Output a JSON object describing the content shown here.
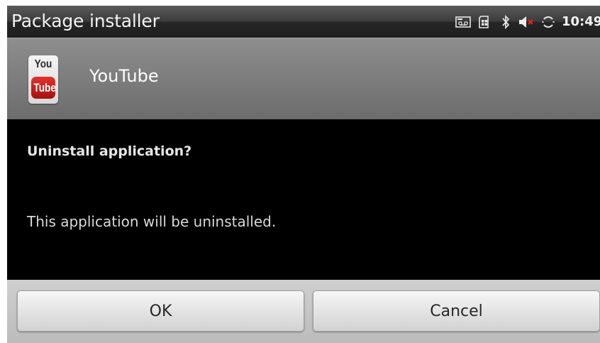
{
  "titlebar": {
    "title": "Package installer",
    "clock": "10:49",
    "status_icons": [
      "voicemail-icon",
      "sim-card-icon",
      "bluetooth-icon",
      "volume-muted-icon",
      "sync-icon"
    ]
  },
  "app": {
    "name": "YouTube",
    "icon_text_top": "You",
    "icon_text_bottom": "Tube"
  },
  "dialog": {
    "title": "Uninstall application?",
    "message": "This application will be uninstalled."
  },
  "buttons": {
    "ok_label": "OK",
    "cancel_label": "Cancel"
  },
  "colors": {
    "youtube_red": "#c4201b",
    "muted_x": "#e0201c"
  }
}
